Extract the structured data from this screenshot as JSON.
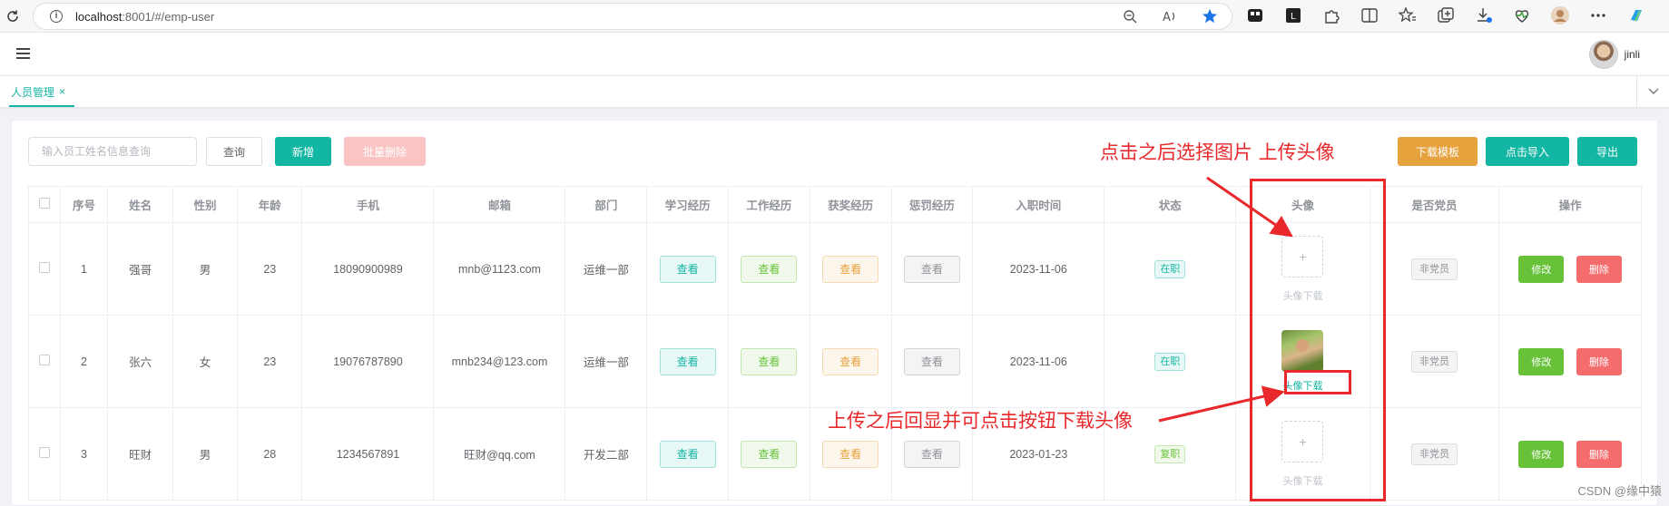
{
  "browser": {
    "url_host": "localhost",
    "url_rest": ":8001/#/emp-user"
  },
  "header": {
    "user_name": "jinli"
  },
  "tabs": [
    {
      "label": "人员管理",
      "close": "×"
    }
  ],
  "toolbar": {
    "search_placeholder": "输入员工姓名信息查询",
    "query_label": "查询",
    "add_label": "新增",
    "batch_delete_label": "批量删除",
    "template_label": "下载模板",
    "import_label": "点击导入",
    "export_label": "导出"
  },
  "table": {
    "headers": [
      "序号",
      "姓名",
      "性别",
      "年龄",
      "手机",
      "邮箱",
      "部门",
      "学习经历",
      "工作经历",
      "获奖经历",
      "惩罚经历",
      "入职时间",
      "状态",
      "头像",
      "是否党员",
      "操作"
    ],
    "view_label": "查看",
    "edit_label": "修改",
    "delete_label": "删除",
    "upload_plus": "+",
    "rows": [
      {
        "index": "1",
        "name": "强哥",
        "gender": "男",
        "age": "23",
        "phone": "18090900989",
        "email": "mnb@1123.com",
        "dept": "运维一部",
        "join_date": "2023-11-06",
        "status": "在职",
        "avatar_uploaded": false,
        "avatar_link": "头像下载",
        "party": "非党员"
      },
      {
        "index": "2",
        "name": "张六",
        "gender": "女",
        "age": "23",
        "phone": "19076787890",
        "email": "mnb234@123.com",
        "dept": "运维一部",
        "join_date": "2023-11-06",
        "status": "在职",
        "avatar_uploaded": true,
        "avatar_link": "头像下载",
        "party": "非党员"
      },
      {
        "index": "3",
        "name": "旺财",
        "gender": "男",
        "age": "28",
        "phone": "1234567891",
        "email": "旺财@qq.com",
        "dept": "开发二部",
        "join_date": "2023-01-23",
        "status": "复职",
        "avatar_uploaded": false,
        "avatar_link": "头像下载",
        "party": "非党员"
      }
    ]
  },
  "annotations": {
    "top": "点击之后选择图片 上传头像",
    "bottom": "上传之后回显并可点击按钮下载头像"
  },
  "watermark": "CSDN @缘中猿",
  "colors": {
    "accent": "#13b5a3",
    "annotation": "#e8282b"
  }
}
